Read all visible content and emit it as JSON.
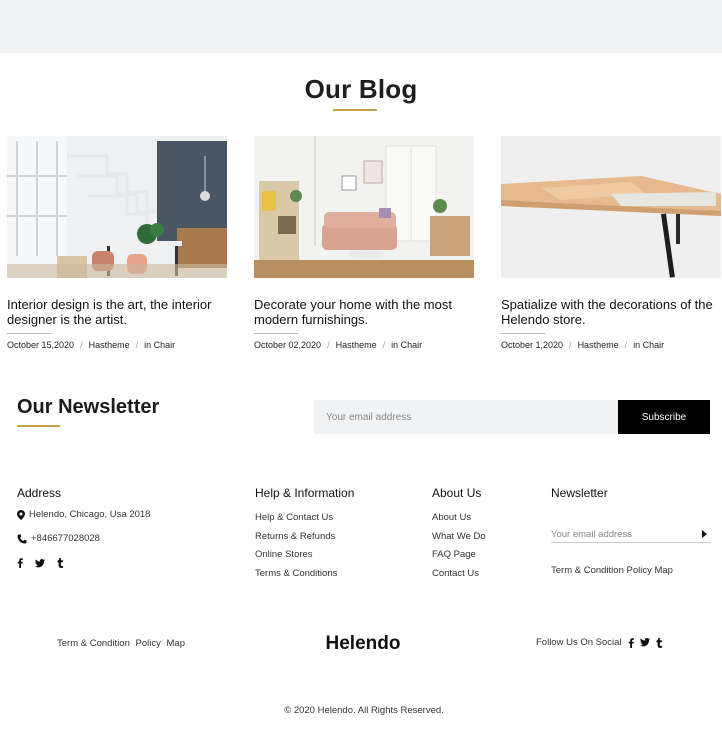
{
  "blog": {
    "title": "Our Blog",
    "posts": [
      {
        "title": "Interior design is the art, the interior designer is the artist.",
        "date": "October 15,2020",
        "author": "Hastheme",
        "category": "in Chair"
      },
      {
        "title": "Decorate your home with the most modern furnishings.",
        "date": "October 02,2020",
        "author": "Hastheme",
        "category": "in Chair"
      },
      {
        "title": "Spatialize with the decorations of the Helendo store.",
        "date": "October 1,2020",
        "author": "Hastheme",
        "category": "in Chair"
      }
    ]
  },
  "newsletter": {
    "title": "Our Newsletter",
    "placeholder": "Your email address",
    "button": "Subscribe"
  },
  "footer": {
    "address": {
      "heading": "Address",
      "location": "Helendo, Chicago, Usa 2018",
      "phone": "+846677028028",
      "socials": [
        "facebook-icon",
        "twitter-icon",
        "tumblr-icon"
      ]
    },
    "help": {
      "heading": "Help & Information",
      "links": [
        "Help & Contact Us",
        "Returns & Refunds",
        "Online Stores",
        "Terms & Conditions"
      ]
    },
    "about": {
      "heading": "About Us",
      "links": [
        "About Us",
        "What We Do",
        "FAQ Page",
        "Contact Us"
      ]
    },
    "newsletter": {
      "heading": "Newsletter",
      "placeholder": "Your email address",
      "links_text": "Term & Condition Policy Map"
    }
  },
  "bottom": {
    "links": [
      "Term & Condition",
      "Policy",
      "Map"
    ],
    "brand": "Helendo",
    "follow": "Follow Us On Social",
    "copyright": "© 2020 Helendo. All Rights Reserved."
  },
  "colors": {
    "accent": "#c9a449",
    "button": "#000000",
    "band": "#f3f4f6"
  }
}
